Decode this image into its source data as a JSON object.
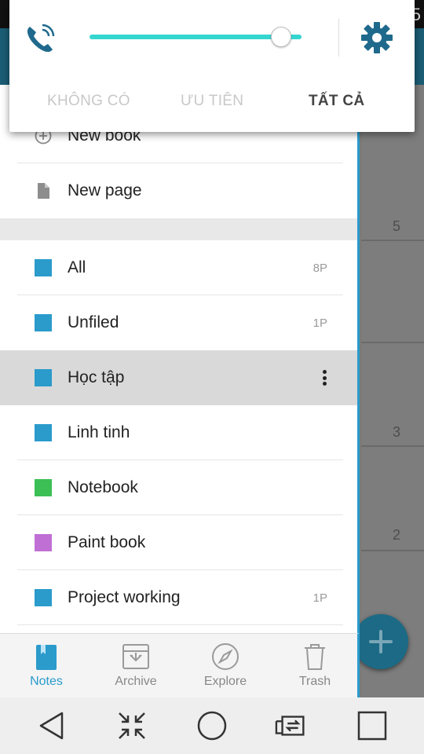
{
  "status": {
    "clock_fragment": "5"
  },
  "quick_panel": {
    "modes": [
      {
        "label": "KHÔNG CÓ",
        "active": false
      },
      {
        "label": "ƯU TIÊN",
        "active": false
      },
      {
        "label": "TẤT CẢ",
        "active": true
      }
    ],
    "volume_fraction": 0.9,
    "accent": "#35d6d0"
  },
  "drawer": {
    "actions": [
      {
        "label": "New book",
        "icon": "plus-circle-icon"
      },
      {
        "label": "New page",
        "icon": "page-icon"
      }
    ],
    "books": [
      {
        "label": "All",
        "count": "8P",
        "color": "#2a9bcb"
      },
      {
        "label": "Unfiled",
        "count": "1P",
        "color": "#2a9bcb"
      },
      {
        "label": "Học tập",
        "count": "",
        "color": "#2a9bcb",
        "selected": true
      },
      {
        "label": "Linh tinh",
        "count": "",
        "color": "#2a9bcb"
      },
      {
        "label": "Notebook",
        "count": "",
        "color": "#3cbf55"
      },
      {
        "label": "Paint book",
        "count": "",
        "color": "#c06fd4"
      },
      {
        "label": "Project working",
        "count": "1P",
        "color": "#2a9bcb"
      }
    ]
  },
  "bottom_nav": [
    {
      "label": "Notes",
      "icon": "notes-icon",
      "active": true
    },
    {
      "label": "Archive",
      "icon": "archive-icon",
      "active": false
    },
    {
      "label": "Explore",
      "icon": "compass-icon",
      "active": false
    },
    {
      "label": "Trash",
      "icon": "trash-icon",
      "active": false
    }
  ],
  "background_counts": [
    "5",
    "3",
    "2"
  ],
  "colors": {
    "accent": "#2a9bcb",
    "selected_row": "#d9d9d9"
  }
}
